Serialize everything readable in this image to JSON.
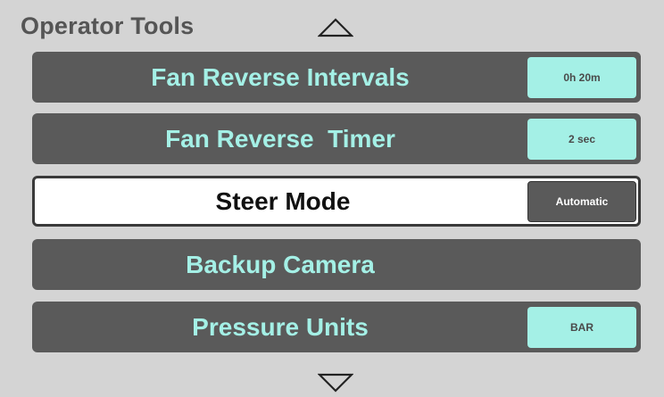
{
  "header": {
    "title": "Operator Tools"
  },
  "nav": {
    "up_icon": "triangle-up-icon",
    "down_icon": "triangle-down-icon"
  },
  "menu": {
    "items": [
      {
        "label": "Fan Reverse Intervals",
        "value": "0h 20m"
      },
      {
        "label": "Fan Reverse  Timer",
        "value": "2 sec"
      },
      {
        "label": "Steer Mode",
        "value": "Automatic",
        "selected": true
      },
      {
        "label": "Backup Camera"
      },
      {
        "label": "Pressure Units",
        "value": "BAR"
      }
    ]
  },
  "colors": {
    "background": "#d4d4d4",
    "row": "#5a5a5a",
    "accent": "#a4f0e6",
    "selected_row": "#ffffff",
    "title_text": "#555555"
  }
}
